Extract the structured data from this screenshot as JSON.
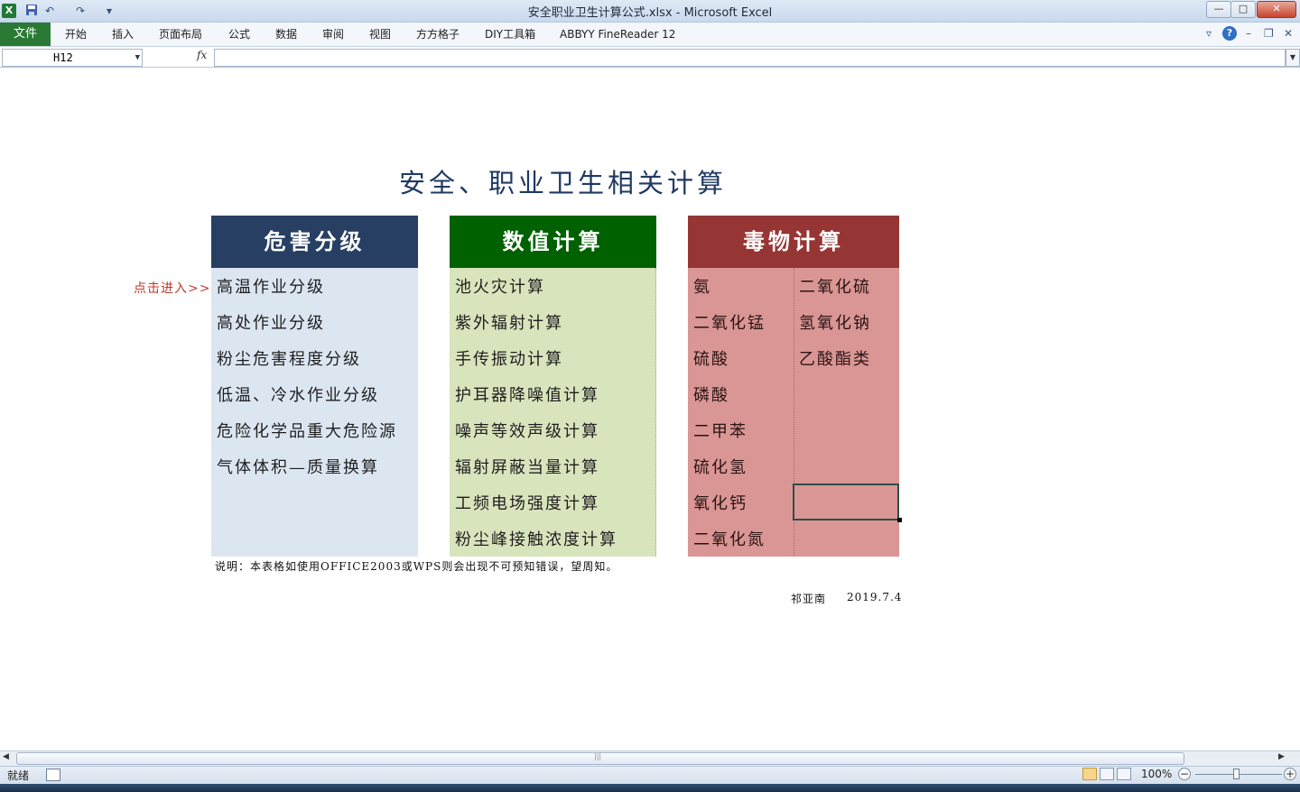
{
  "window": {
    "title": "安全职业卫生计算公式.xlsx - Microsoft Excel",
    "app_icon": "X",
    "controls": {
      "minimize": "—",
      "maximize": "□",
      "close": "✕"
    }
  },
  "quick_access": {
    "save_icon": "save-icon",
    "undo": "↶",
    "redo": "↷",
    "customize": "▾"
  },
  "ribbon": {
    "file_tab": "文件",
    "tabs": [
      "开始",
      "插入",
      "页面布局",
      "公式",
      "数据",
      "审阅",
      "视图",
      "方方格子",
      "DIY工具箱",
      "ABBYY FineReader 12"
    ]
  },
  "formula_bar": {
    "name_box": "H12",
    "fx": "fx",
    "formula": ""
  },
  "sheet": {
    "title": "安全、职业卫生相关计算",
    "click_hint": "点击进入>>",
    "panels": {
      "hazard": {
        "header": "危害分级",
        "items": [
          "高温作业分级",
          "高处作业分级",
          "粉尘危害程度分级",
          "低温、冷水作业分级",
          "危险化学品重大危险源",
          "气体体积—质量换算"
        ]
      },
      "numeric": {
        "header": "数值计算",
        "items": [
          "池火灾计算",
          "紫外辐射计算",
          "手传振动计算",
          "护耳器降噪值计算",
          "噪声等效声级计算",
          "辐射屏蔽当量计算",
          "工频电场强度计算",
          "粉尘峰接触浓度计算"
        ]
      },
      "toxic": {
        "header": "毒物计算",
        "left_items": [
          "氨",
          "二氧化锰",
          "硫酸",
          "磷酸",
          "二甲苯",
          "硫化氢",
          "氧化钙",
          "二氧化氮"
        ],
        "right_items": [
          "二氧化硫",
          "氢氧化钠",
          "乙酸酯类"
        ]
      }
    },
    "note": "说明：本表格如使用OFFICE2003或WPS则会出现不可预知错误，望周知。",
    "author": "祁亚南",
    "date": "2019.7.4"
  },
  "status_bar": {
    "ready": "就绪",
    "zoom": "100%",
    "zoom_level": 1.0
  },
  "colors": {
    "hazard_header": "#263f63",
    "hazard_body": "#dce6f1",
    "numeric_header": "#006100",
    "numeric_body": "#d8e4bc",
    "toxic_header": "#963634",
    "toxic_body": "#da9694",
    "title": "#1f3a63",
    "hint": "#c0392b"
  }
}
